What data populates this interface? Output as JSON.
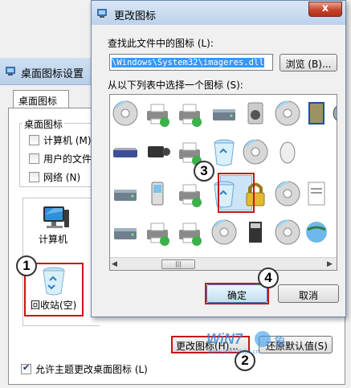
{
  "background_dialog": {
    "title": "桌面图标设置",
    "tab_label": "桌面图标",
    "group_label": "桌面图标",
    "checkboxes": [
      {
        "label": "计算机 (M)",
        "checked": false
      },
      {
        "label": "用户的文件",
        "checked": false
      },
      {
        "label": "网络 (N)",
        "checked": false
      }
    ],
    "icons": [
      {
        "label": "计算机",
        "icon": "computer-icon"
      },
      {
        "label": "回收站(空)",
        "icon": "recycle-bin-icon"
      }
    ],
    "change_icon_button": "更改图标(H)...",
    "restore_default_button": "还原默认值(S)",
    "allow_themes_checkbox": {
      "label": "允许主题更改桌面图标 (L)",
      "checked": true
    }
  },
  "change_icon_dialog": {
    "title": "更改图标",
    "close_symbol": "x",
    "lookfor_label": "查找此文件中的图标 (L):",
    "path_value": "\\Windows\\System32\\imageres.dll",
    "browse_button": "浏览 (B)...",
    "select_label": "从以下列表中选择一个图标 (S):",
    "ok_button": "确定",
    "cancel_button": "取消",
    "icons": [
      "dvd-rw-drive-icon",
      "network-printer-icon",
      "printer-ok-icon",
      "network-drive-icon",
      "speaker-icon",
      "disc-icon",
      "blue-book-icon",
      "gear-icon",
      "scanner-icon",
      "camcorder-icon",
      "fax-printer-icon",
      "recycle-bin-full-icon",
      "cd-r-drive-icon",
      "mouse-icon",
      "drive-icon",
      "mobile-phone-icon",
      "printer-icon",
      "recycle-bin-empty-icon",
      "padlock-icon",
      "cd-rom-drive-icon",
      "document-icon",
      "hard-drive-icon",
      "floppy-printer-icon",
      "printer-check-icon",
      "dvd-disc-icon",
      "media-card-icon",
      "cd-rw-drive-icon",
      "network-globe-icon"
    ],
    "selected_icon": "recycle-bin-empty-icon"
  },
  "callouts": [
    "1",
    "2",
    "3",
    "4"
  ],
  "watermark": "WIN7系统之家 www.win7zhijia.cn",
  "colors": {
    "highlight": "#c81414",
    "selection": "#cce4f7",
    "path_selection": "#3399ff"
  }
}
